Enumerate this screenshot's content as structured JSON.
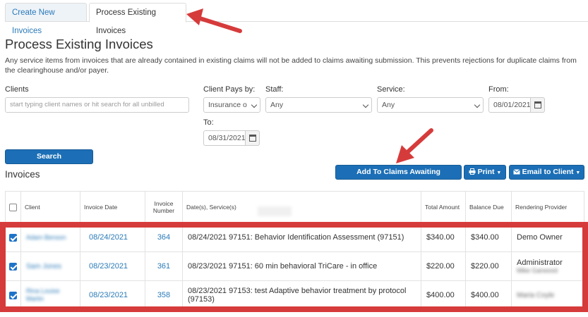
{
  "tabs": {
    "create": "Create New Invoices",
    "process": "Process Existing Invoices"
  },
  "page": {
    "title": "Process Existing Invoices",
    "description": "Any service items from invoices that are already contained in existing claims will not be added to claims awaiting submission. This prevents rejections for duplicate claims from the clearinghouse and/or payer."
  },
  "filters": {
    "clients_label": "Clients",
    "clients_placeholder": "start typing client names or hit search for all unbilled",
    "client_pays_label": "Client Pays by:",
    "client_pays_value": "Insurance o",
    "staff_label": "Staff:",
    "staff_value": "Any",
    "service_label": "Service:",
    "service_value": "Any",
    "from_label": "From:",
    "from_value": "08/01/2021",
    "to_label": "To:",
    "to_value": "08/31/2021",
    "search_button": "Search"
  },
  "invoices": {
    "title": "Invoices",
    "add_button": "Add To Claims Awaiting Submission",
    "print_button": "Print",
    "email_button": "Email to Client",
    "columns": [
      "Client",
      "Invoice Date",
      "Invoice Number",
      "Date(s), Service(s)",
      "Total Amount",
      "Balance Due",
      "Rendering Provider"
    ],
    "rows": [
      {
        "client": "Adam Benson",
        "date": "08/24/2021",
        "number": "364",
        "service": "08/24/2021 97151: Behavior Identification Assessment (97151)",
        "total": "$340.00",
        "balance": "$340.00",
        "provider": "Demo Owner",
        "provider_sub": ""
      },
      {
        "client": "Sam Jones",
        "date": "08/23/2021",
        "number": "361",
        "service": "08/23/2021 97151: 60 min behavioral TriCare - in office",
        "total": "$220.00",
        "balance": "$220.00",
        "provider": "Administrator",
        "provider_sub": "Mike Garwood"
      },
      {
        "client": "Rina Louise Martin",
        "date": "08/23/2021",
        "number": "358",
        "service": "08/23/2021 97153: test Adaptive behavior treatment by protocol (97153)",
        "total": "$400.00",
        "balance": "$400.00",
        "provider": "Maria Coyle",
        "provider_sub": ""
      }
    ]
  },
  "colors": {
    "primary": "#1c6fb6",
    "link": "#2a7ab8",
    "annotation_red": "#d63b3b"
  }
}
